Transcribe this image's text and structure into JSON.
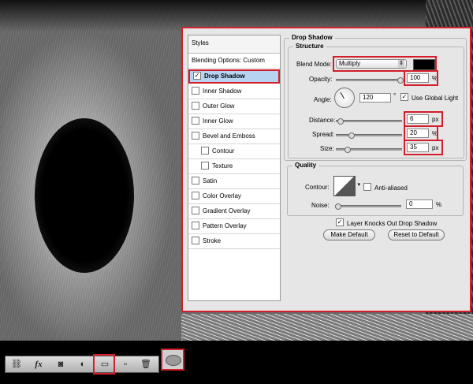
{
  "styles_panel": {
    "header": "Styles",
    "blending_options": "Blending Options: Custom",
    "items": [
      {
        "label": "Drop Shadow",
        "checked": true,
        "selected": true,
        "indent": false
      },
      {
        "label": "Inner Shadow",
        "checked": false,
        "indent": false
      },
      {
        "label": "Outer Glow",
        "checked": false,
        "indent": false
      },
      {
        "label": "Inner Glow",
        "checked": false,
        "indent": false
      },
      {
        "label": "Bevel and Emboss",
        "checked": false,
        "indent": false
      },
      {
        "label": "Contour",
        "checked": false,
        "indent": true
      },
      {
        "label": "Texture",
        "checked": false,
        "indent": true
      },
      {
        "label": "Satin",
        "checked": false,
        "indent": false
      },
      {
        "label": "Color Overlay",
        "checked": false,
        "indent": false
      },
      {
        "label": "Gradient Overlay",
        "checked": false,
        "indent": false
      },
      {
        "label": "Pattern Overlay",
        "checked": false,
        "indent": false
      },
      {
        "label": "Stroke",
        "checked": false,
        "indent": false
      }
    ]
  },
  "drop_shadow": {
    "title": "Drop Shadow",
    "structure": {
      "title": "Structure",
      "blend_mode_label": "Blend Mode:",
      "blend_mode_value": "Multiply",
      "shadow_color": "#000000",
      "opacity_label": "Opacity:",
      "opacity_value": "100",
      "opacity_unit": "%",
      "opacity_fraction": 1.0,
      "angle_label": "Angle:",
      "angle_value": "120",
      "angle_unit": "°",
      "use_global_light_label": "Use Global Light",
      "use_global_light": true,
      "distance_label": "Distance:",
      "distance_value": "6",
      "distance_unit": "px",
      "distance_fraction": 0.02,
      "spread_label": "Spread:",
      "spread_value": "20",
      "spread_unit": "%",
      "spread_fraction": 0.2,
      "size_label": "Size:",
      "size_value": "35",
      "size_unit": "px",
      "size_fraction": 0.14
    },
    "quality": {
      "title": "Quality",
      "contour_label": "Contour:",
      "anti_aliased_label": "Anti-aliased",
      "anti_aliased": false,
      "noise_label": "Noise:",
      "noise_value": "0",
      "noise_unit": "%",
      "noise_fraction": 0.0
    },
    "layer_knocks_out_label": "Layer Knocks Out Drop Shadow",
    "layer_knocks_out": true,
    "make_default_label": "Make Default",
    "reset_default_label": "Reset to Default"
  },
  "toolbar": {
    "icons": [
      "link-icon",
      "fx-icon",
      "mask-icon",
      "adjustment-icon",
      "folder-icon",
      "new-layer-icon",
      "trash-icon"
    ],
    "fx_label": "fx"
  },
  "colors": {
    "highlight_red": "#d21f2b",
    "selection_blue": "#b7d3f2"
  }
}
